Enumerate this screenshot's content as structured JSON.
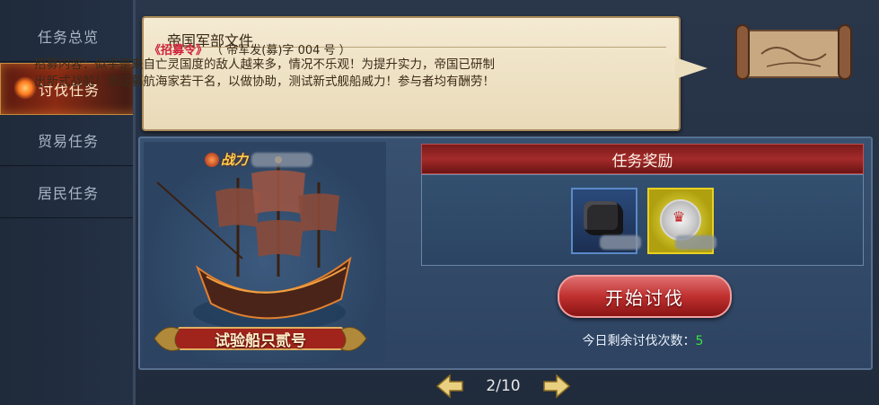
{
  "sidebar": {
    "items": [
      {
        "label": "任务总览",
        "active": false
      },
      {
        "label": "讨伐任务",
        "active": true
      },
      {
        "label": "贸易任务",
        "active": false
      },
      {
        "label": "居民任务",
        "active": false
      }
    ]
  },
  "notice": {
    "title": "帝国军部文件",
    "order_name": "《招募令》",
    "order_code": "（ 帝军发(募)字 004 号 ）",
    "body": "招募内容：似乎是来自亡灵国度的敌人越来多，情况不乐观！为提升实力，帝国已研制出新式战船！现征募航海家若干名，以做协助，测试新式舰船威力！参与者均有酬劳！"
  },
  "ship": {
    "power_label": "战力",
    "name": "试验船只贰号",
    "icon": "ship-icon"
  },
  "reward": {
    "title": "任务奖励",
    "items": [
      {
        "icon": "coal-ore-icon"
      },
      {
        "icon": "silver-crown-coin-icon"
      }
    ]
  },
  "start_button": "开始讨伐",
  "remaining": {
    "label": "今日剩余讨伐次数：",
    "value": "5"
  },
  "pager": {
    "text": "2/10"
  },
  "colors": {
    "accent_red": "#c03030",
    "highlight_green": "#3ee040",
    "parchment": "#efe3c6"
  }
}
